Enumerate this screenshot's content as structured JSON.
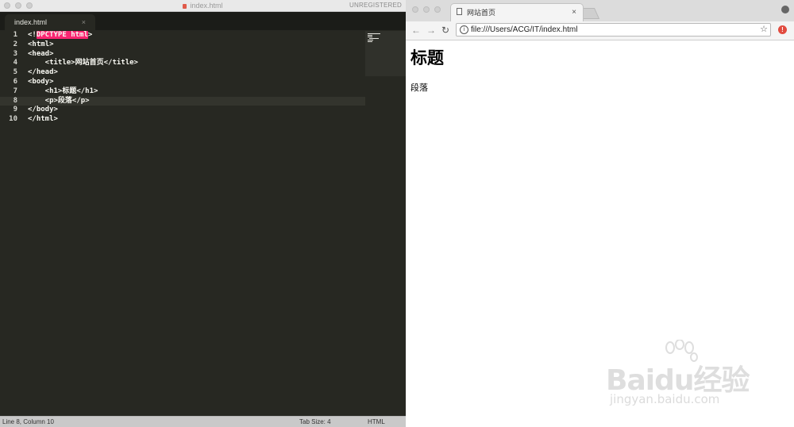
{
  "editor": {
    "window_title": "index.html",
    "registration": "UNREGISTERED",
    "tab_label": "index.html",
    "tab_close": "×",
    "current_line": 8,
    "lines": [
      {
        "num": "1",
        "pre": "<!",
        "hl": "DPCTYPE html",
        "post": ">"
      },
      {
        "num": "2",
        "text": "<html>"
      },
      {
        "num": "3",
        "text": "<head>"
      },
      {
        "num": "4",
        "text": "    <title>网站首页</title>"
      },
      {
        "num": "5",
        "text": "</head>"
      },
      {
        "num": "6",
        "text": "<body>"
      },
      {
        "num": "7",
        "text": "    <h1>标题</h1>"
      },
      {
        "num": "8",
        "text": "    <p>段落</p>"
      },
      {
        "num": "9",
        "text": "</body>"
      },
      {
        "num": "10",
        "text": "</html>"
      }
    ],
    "status": {
      "position": "Line 8, Column 10",
      "tab_size": "Tab Size: 4",
      "syntax": "HTML"
    }
  },
  "browser": {
    "tab_title": "网站首页",
    "tab_close": "×",
    "url": "file:///Users/ACG/IT/index.html",
    "back": "←",
    "forward": "→",
    "reload": "↻",
    "star": "☆",
    "info": "i",
    "page": {
      "heading": "标题",
      "paragraph": "段落"
    }
  },
  "watermark": {
    "brand": "Baidu经验",
    "url": "jingyan.baidu.com"
  },
  "icons": {
    "page": "page-icon",
    "info": "info-icon",
    "star": "star-icon",
    "profile": "profile-icon",
    "extension": "extension-icon"
  },
  "colors": {
    "editor_bg": "#272822",
    "highlight": "#f92672",
    "text": "#f8f8f2"
  }
}
